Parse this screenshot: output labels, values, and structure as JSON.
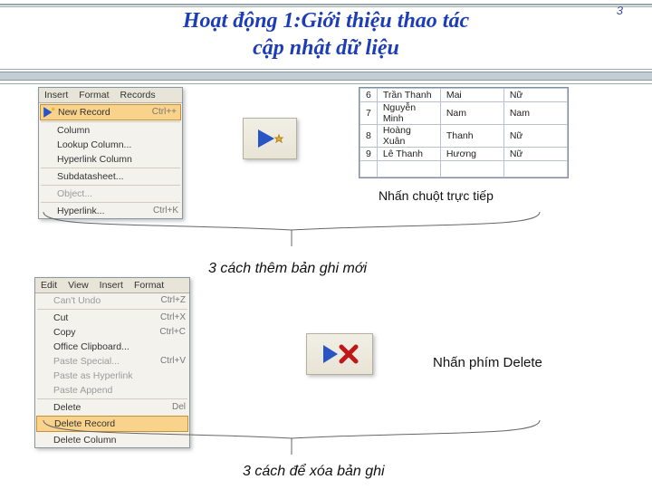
{
  "page_number": "3",
  "title_line1": "Hoạt động 1:Giới thiệu thao tác",
  "title_line2": "cập nhật dữ liệu",
  "insert_menu": {
    "bar": [
      "Insert",
      "Format",
      "Records"
    ],
    "items": [
      {
        "label": "New Record",
        "accel": "Ctrl++",
        "sel": true
      },
      {
        "sep": true
      },
      {
        "label": "Column"
      },
      {
        "label": "Lookup Column..."
      },
      {
        "label": "Hyperlink Column"
      },
      {
        "sep": true
      },
      {
        "label": "Subdatasheet..."
      },
      {
        "sep": true
      },
      {
        "label": "Object...",
        "dim": true
      },
      {
        "sep": true
      },
      {
        "label": "Hyperlink...",
        "accel": "Ctrl+K"
      }
    ]
  },
  "sample_table": {
    "rows": [
      {
        "n": "6",
        "c1": "Trần Thanh",
        "c2": "Mai",
        "c3": "Nữ"
      },
      {
        "n": "7",
        "c1": "Nguyễn Minh",
        "c2": "Nam",
        "c3": "Nam"
      },
      {
        "n": "8",
        "c1": "Hoàng Xuân",
        "c2": "Thanh",
        "c3": "Nữ"
      },
      {
        "n": "9",
        "c1": "Lê Thanh",
        "c2": "Hương",
        "c3": "Nữ"
      }
    ]
  },
  "caption_click": "Nhấn chuột trực tiếp",
  "caption_three_ways_add": "3 cách thêm bản ghi mới",
  "caption_press_delete": "Nhấn phím Delete",
  "caption_three_ways_del": "3 cách để xóa bản ghi",
  "edit_menu": {
    "bar": [
      "Edit",
      "View",
      "Insert",
      "Format"
    ],
    "items": [
      {
        "label": "Can't Undo",
        "accel": "Ctrl+Z",
        "dim": true
      },
      {
        "sep": true
      },
      {
        "label": "Cut",
        "accel": "Ctrl+X"
      },
      {
        "label": "Copy",
        "accel": "Ctrl+C"
      },
      {
        "label": "Office Clipboard..."
      },
      {
        "label": "Paste Special...",
        "accel": "Ctrl+V",
        "dim": true
      },
      {
        "label": "Paste as Hyperlink",
        "dim": true
      },
      {
        "label": "Paste Append",
        "dim": true
      },
      {
        "sep": true
      },
      {
        "label": "Delete",
        "accel": "Del"
      },
      {
        "label": "Delete Record",
        "sel": true
      },
      {
        "label": "Delete Column"
      }
    ]
  }
}
